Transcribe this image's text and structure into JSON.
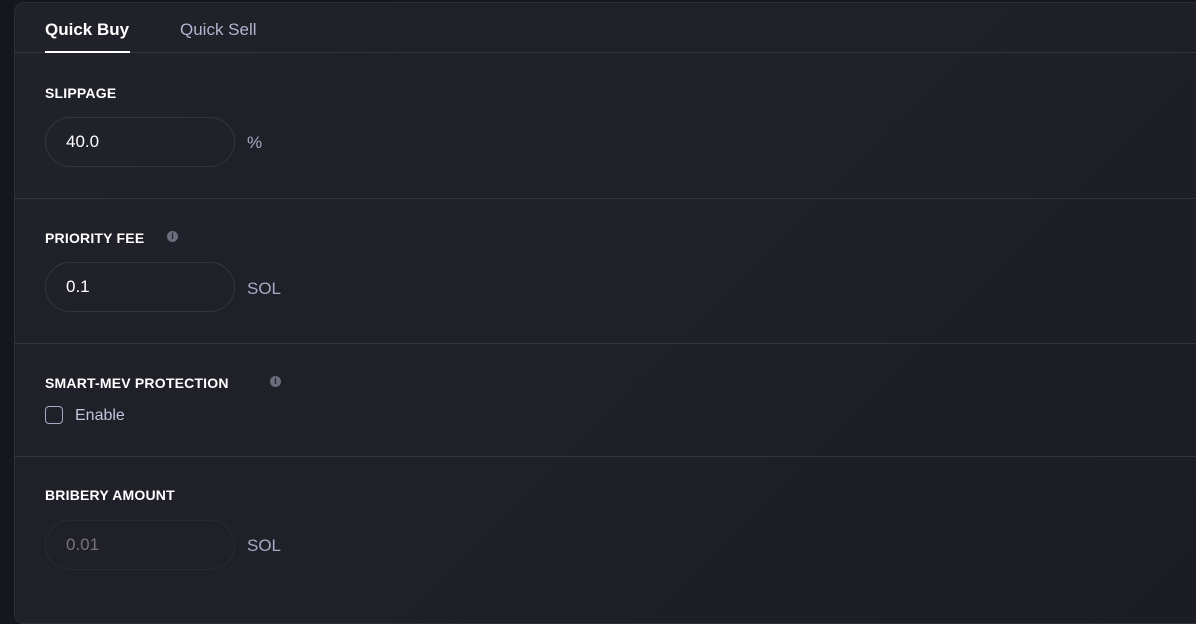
{
  "tabs": [
    {
      "label": "Quick Buy",
      "active": true
    },
    {
      "label": "Quick Sell",
      "active": false
    }
  ],
  "slippage": {
    "label": "SLIPPAGE",
    "value": "40.0",
    "unit": "%"
  },
  "priority_fee": {
    "label": "PRIORITY FEE",
    "value": "0.1",
    "unit": "SOL",
    "icon": "info-icon"
  },
  "mev": {
    "label": "SMART-MEV PROTECTION",
    "icon": "info-icon",
    "checkbox_label": "Enable",
    "checked": false
  },
  "bribery": {
    "label": "BRIBERY AMOUNT",
    "placeholder": "0.01",
    "unit": "SOL",
    "disabled": true
  },
  "colors": {
    "background": "#1f2028",
    "accent": "#ffffff",
    "muted": "#a8a9c6",
    "border": "#34353d"
  }
}
